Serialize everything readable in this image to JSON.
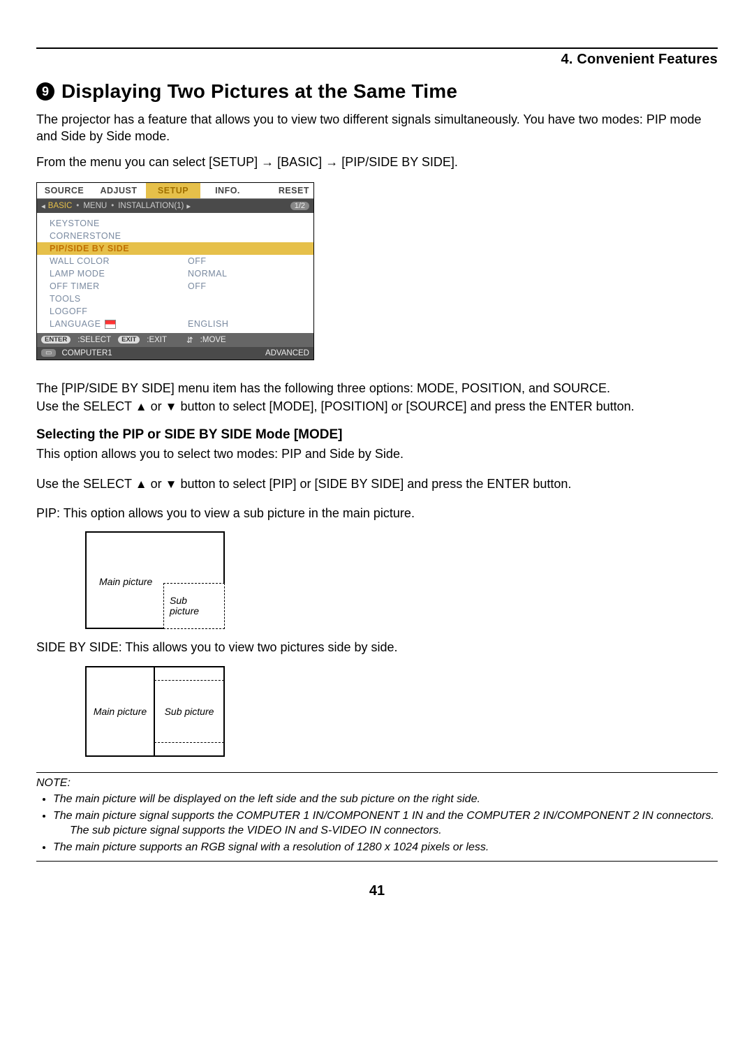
{
  "header": {
    "chapter": "4. Convenient Features"
  },
  "section": {
    "number": "9",
    "title": "Displaying Two Pictures at the Same Time",
    "intro": "The projector has a feature that allows you to view two different signals simultaneously. You have two modes: PIP mode and Side by Side mode.",
    "menu_path_prefix": "From the menu you can select [SETUP] ",
    "menu_path_mid1": " [BASIC] ",
    "menu_path_mid2": " [PIP/SIDE BY SIDE].",
    "arrow": "→"
  },
  "osd": {
    "tabs": [
      "SOURCE",
      "ADJUST",
      "SETUP",
      "INFO.",
      "RESET"
    ],
    "active_tab_index": 2,
    "subtabs_left_arrow": "◂",
    "subtabs_right_arrow": "▸",
    "subtabs": [
      "BASIC",
      "MENU",
      "INSTALLATION(1)"
    ],
    "active_subtab_index": 0,
    "page_indicator": "1/2",
    "rows": [
      {
        "label": "KEYSTONE",
        "value": ""
      },
      {
        "label": "CORNERSTONE",
        "value": ""
      },
      {
        "label": "PIP/SIDE BY SIDE",
        "value": "",
        "highlight": true
      },
      {
        "label": "WALL COLOR",
        "value": "OFF"
      },
      {
        "label": "LAMP MODE",
        "value": "NORMAL"
      },
      {
        "label": "OFF TIMER",
        "value": "OFF"
      },
      {
        "label": "TOOLS",
        "value": ""
      },
      {
        "label": "LOGOFF",
        "value": ""
      },
      {
        "label": "LANGUAGE",
        "value": "ENGLISH",
        "lang_icon": true
      }
    ],
    "help": {
      "enter_pill": "ENTER",
      "enter_label": ":SELECT",
      "exit_pill": "EXIT",
      "exit_label": ":EXIT",
      "move_glyph": "⇵",
      "move_label": ":MOVE"
    },
    "status": {
      "source_icon": "▭",
      "source_label": "COMPUTER1",
      "right_label": "ADVANCED"
    }
  },
  "after_osd": {
    "p1": "The [PIP/SIDE BY SIDE] menu item has the following three options: MODE, POSITION, and SOURCE.",
    "p2_prefix": "Use the SELECT ",
    "up": "▲",
    "or": " or ",
    "down": "▼",
    "p2_suffix": " button to select [MODE], [POSITION] or [SOURCE] and press the ENTER button."
  },
  "mode_section": {
    "heading": "Selecting the PIP or SIDE BY SIDE Mode [MODE]",
    "p1": "This option allows you to select two modes: PIP and Side by Side.",
    "p2_prefix": "Use the SELECT ",
    "p2_suffix": " button to select [PIP] or [SIDE BY SIDE] and press the ENTER button.",
    "pip_desc": "PIP: This option allows you to view a sub picture in the main picture.",
    "pip_main_label": "Main picture",
    "pip_sub_label": "Sub\npicture",
    "sbs_desc": "SIDE BY SIDE: This allows you to view two pictures side by side.",
    "sbs_main_label": "Main picture",
    "sbs_sub_label": "Sub picture"
  },
  "note": {
    "title": "NOTE:",
    "items": [
      "The main picture will be displayed on the left side and the sub picture on the right side.",
      "The main picture signal supports the COMPUTER 1 IN/COMPONENT 1 IN and the COMPUTER 2  IN/COMPONENT 2 IN connectors.",
      "The main picture supports an RGB signal with a resolution of 1280 x 1024 pixels or less."
    ],
    "subline": "The sub picture signal supports the VIDEO IN and S-VIDEO IN connectors."
  },
  "page_number": "41"
}
